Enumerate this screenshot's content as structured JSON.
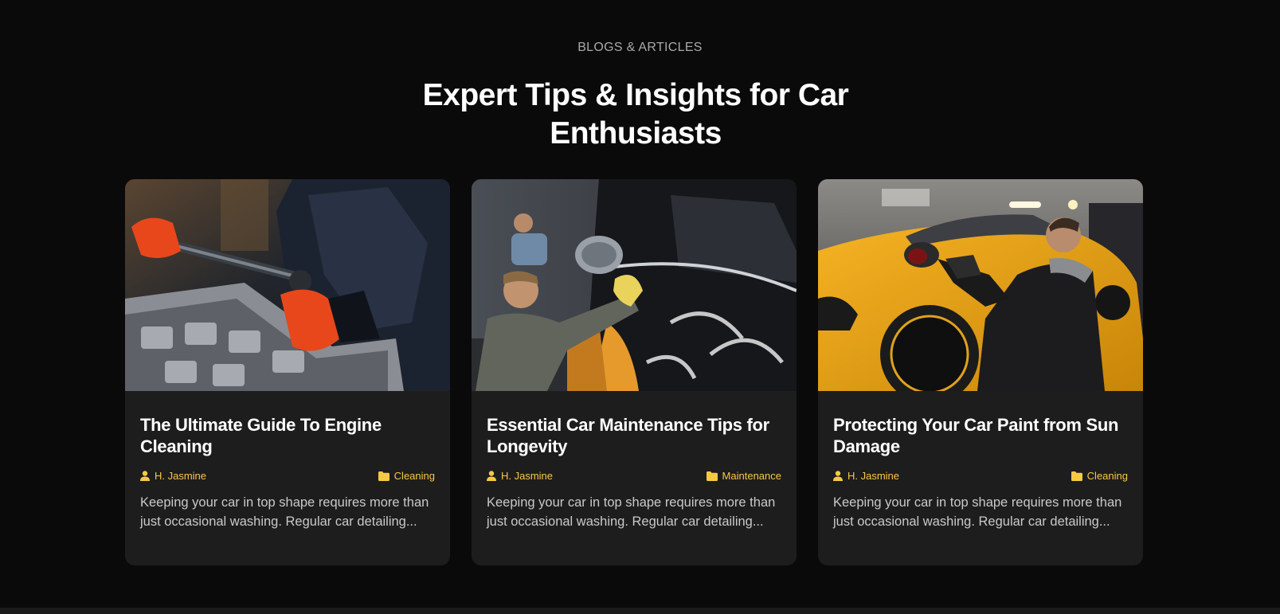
{
  "section": {
    "eyebrow": "BLOGS & ARTICLES",
    "headline": "Expert Tips & Insights for Car Enthusiasts"
  },
  "icons": {
    "author": "user-icon",
    "category": "folder-icon"
  },
  "colors": {
    "background": "#0a0a0a",
    "card": "#1d1d1d",
    "accent": "#f6c945"
  },
  "cards": [
    {
      "title": "The Ultimate Guide To Engine Cleaning",
      "author": "H. Jasmine",
      "category": "Cleaning",
      "excerpt": "Keeping your car in top shape requires more than just occasional washing. Regular car detailing...",
      "image": "mechanic-torque-wrench-engine"
    },
    {
      "title": "Essential Car Maintenance Tips for Longevity",
      "author": "H. Jasmine",
      "category": "Maintenance",
      "excerpt": "Keeping your car in top shape requires more than just occasional washing. Regular car detailing...",
      "image": "detailers-wiping-black-car"
    },
    {
      "title": "Protecting Your Car Paint from Sun Damage",
      "author": "H. Jasmine",
      "category": "Cleaning",
      "excerpt": "Keeping your car in top shape requires more than just occasional washing. Regular car detailing...",
      "image": "man-polishing-yellow-sports-car"
    }
  ]
}
